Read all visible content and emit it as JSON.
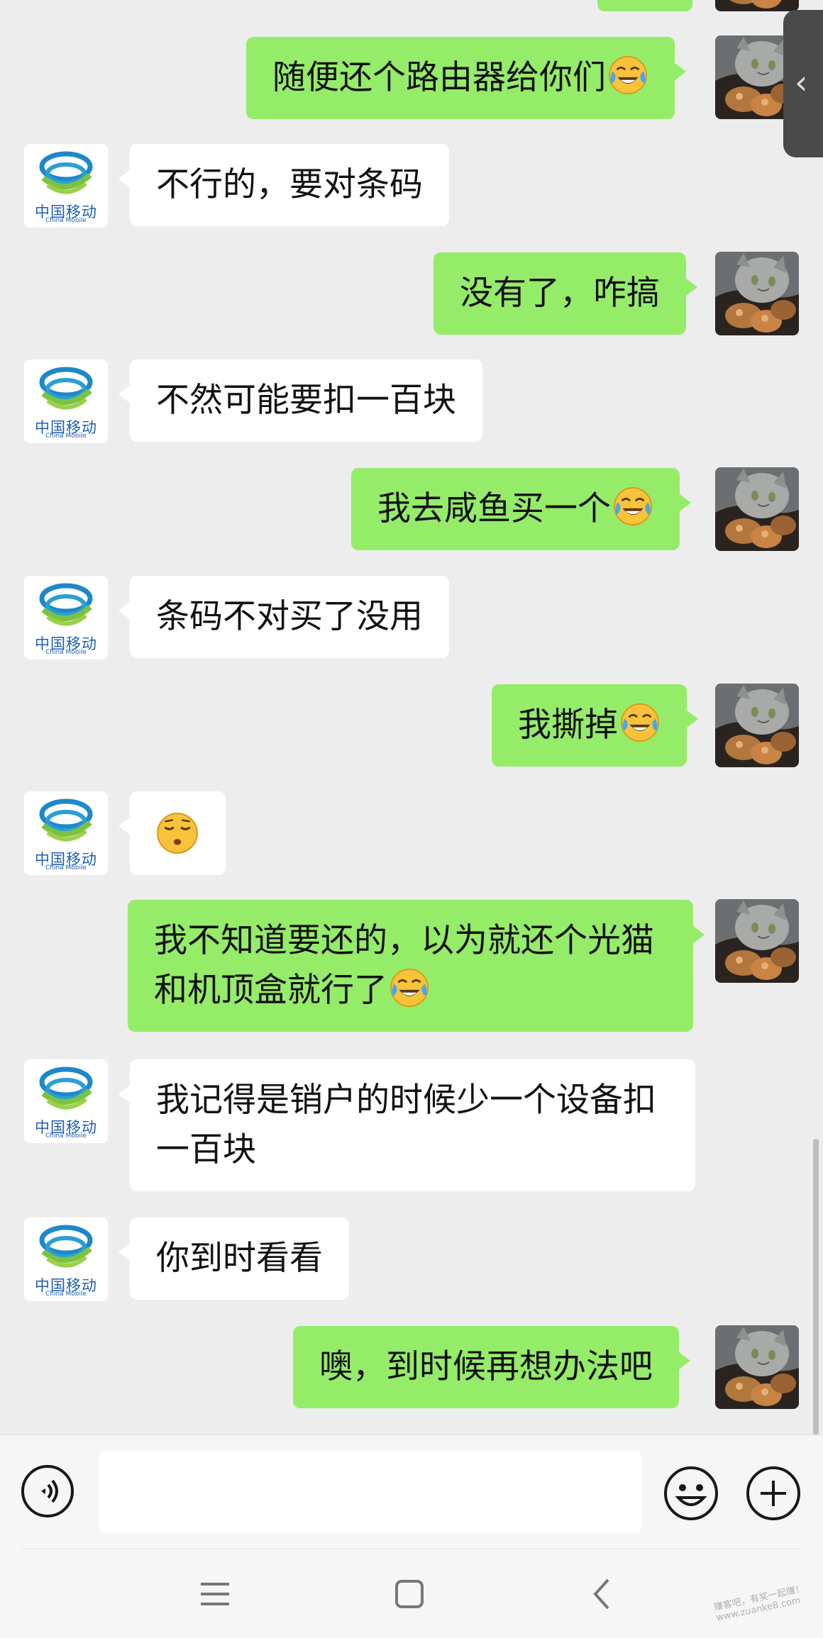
{
  "messages": [
    {
      "from": "me",
      "text": "随便还个路由器给你们",
      "emoji": "crying-laughing"
    },
    {
      "from": "them",
      "text": "不行的，要对条码"
    },
    {
      "from": "me",
      "text": "没有了，咋搞"
    },
    {
      "from": "them",
      "text": "不然可能要扣一百块"
    },
    {
      "from": "me",
      "text": "我去咸鱼买一个",
      "emoji": "crying-laughing"
    },
    {
      "from": "them",
      "text": "条码不对买了没用"
    },
    {
      "from": "me",
      "text": "我撕掉",
      "emoji": "crying-laughing"
    },
    {
      "from": "them",
      "text": "",
      "emoji": "relieved-face"
    },
    {
      "from": "me",
      "line1": "我不知道要还的，以为就还个光猫",
      "line2": "和机顶盒就行了",
      "emoji": "crying-laughing"
    },
    {
      "from": "them",
      "line1": "我记得是销户的时候少一个设备扣",
      "line2": "一百块"
    },
    {
      "from": "them",
      "text": "你到时看看"
    },
    {
      "from": "me",
      "text": "噢，到时候再想办法吧"
    }
  ],
  "contact_logo": {
    "zh": "中国移动",
    "en": "China Mobile"
  },
  "colors": {
    "my_bubble": "#95ec69",
    "their_bubble": "#ffffff",
    "background": "#ededed"
  },
  "watermark": "赚客吧，有奖一起赚！ www.zuanke8.com"
}
